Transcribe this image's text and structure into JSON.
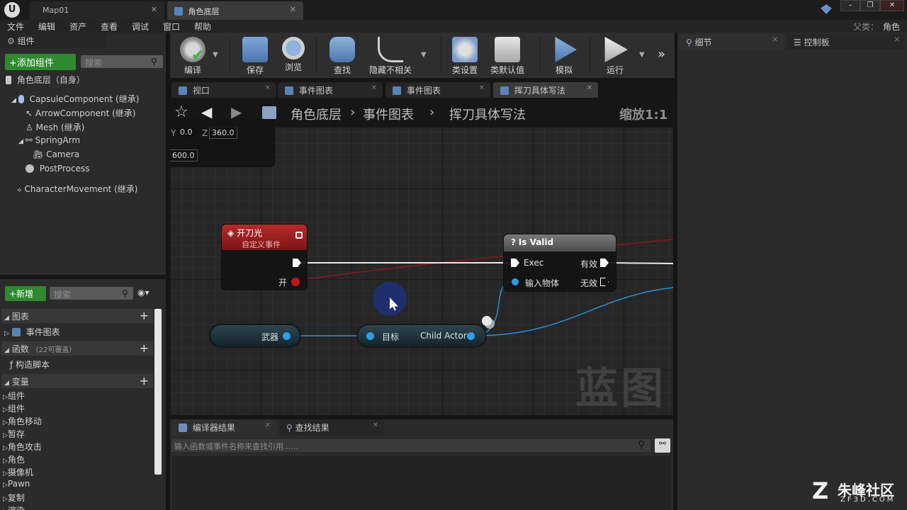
{
  "titlebar": {
    "tabs": [
      {
        "label": "Map01",
        "active": false
      },
      {
        "label": "角色底层",
        "active": true
      }
    ],
    "parent_label": "父类：",
    "parent_value": "角色"
  },
  "menu": [
    "文件",
    "编辑",
    "资产",
    "查看",
    "调试",
    "窗口",
    "帮助"
  ],
  "components_panel": {
    "title": "组件",
    "add_button": "+添加组件",
    "search_placeholder": "搜索",
    "root": "角色底层（自身）",
    "items": [
      {
        "label": "CapsuleComponent (继承)"
      },
      {
        "label": "ArrowComponent (继承)"
      },
      {
        "label": "Mesh (继承)"
      },
      {
        "label": "SpringArm"
      },
      {
        "label": "Camera"
      },
      {
        "label": "PostProcess"
      },
      {
        "label": "CharacterMovement (继承)"
      }
    ]
  },
  "mybp_panel": {
    "new_button": "+新增",
    "search_placeholder": "搜索",
    "graphs_header": "图表",
    "event_graph": "事件图表",
    "functions_header": "函数",
    "functions_note": "（22可覆盖）",
    "construct_script": "构造脚本",
    "variables_header": "变量",
    "categories": [
      "组件",
      "组件",
      "角色移动",
      "暂存",
      "角色攻击",
      "角色",
      "摄像机",
      "Pawn",
      "复制",
      "渲染"
    ]
  },
  "toolbar": {
    "items": [
      "编译",
      "保存",
      "浏览",
      "查找",
      "隐藏不相关",
      "类设置",
      "类默认值",
      "模拟",
      "运行"
    ]
  },
  "doc_tabs": [
    "视口",
    "事件图表",
    "事件图表",
    "挥刀具体写法"
  ],
  "graph": {
    "breadcrumb": [
      "角色底层",
      "事件图表",
      "挥刀具体写法"
    ],
    "zoom": "缩放1:1",
    "partial_node": {
      "y_label": "Y",
      "y_value": "0.0",
      "z_label": "Z",
      "z_value": "360.0",
      "value2": "600.0"
    },
    "event_node": {
      "title": "开刀光",
      "subtitle": "自定义事件",
      "pin": "开"
    },
    "isvalid_node": {
      "title": "Is Valid",
      "exec_in": "Exec",
      "valid": "有效",
      "object": "输入物体",
      "invalid": "无效"
    },
    "var_node": {
      "label": "武器"
    },
    "child_node": {
      "target": "目标",
      "output": "Child Actor"
    },
    "watermark": "蓝图"
  },
  "bottom_panel": {
    "tabs": [
      "编译器结果",
      "查找结果"
    ],
    "search_placeholder": "输入函数或事件名称来查找引用......"
  },
  "right_panel": {
    "tabs": [
      "细节",
      "控制板"
    ]
  },
  "logo": {
    "brand": "朱峰社区",
    "url": "ZF3D.COM"
  }
}
